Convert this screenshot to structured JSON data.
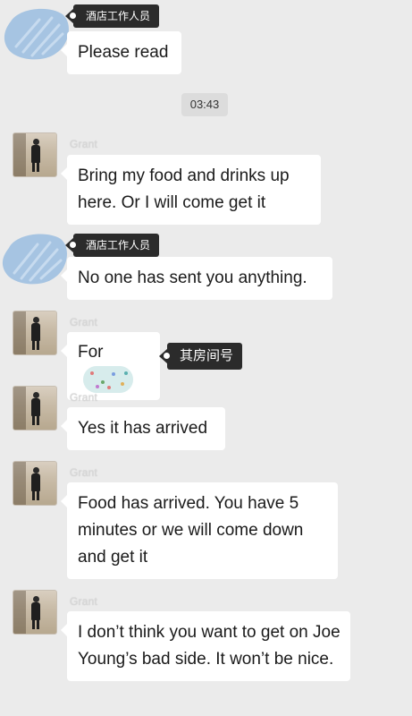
{
  "colors": {
    "background": "#ebebeb",
    "bubble": "#ffffff",
    "tag": "#2b2b2b",
    "avatar_blue": "#9fbfe0",
    "time_chip": "#dcdcdc"
  },
  "time_divider": "03:43",
  "messages": [
    {
      "sender": "酒店工作人员",
      "text": "Please read"
    },
    {
      "sender": "Grant",
      "text": "Bring my food and drinks up here. Or I will come get it"
    },
    {
      "sender": "酒店工作人员",
      "text": "No one has sent you anything."
    },
    {
      "sender": "Grant",
      "text": "For",
      "tag": "其房间号"
    },
    {
      "sender": "Grant",
      "text": "Yes it has arrived"
    },
    {
      "sender": "Grant",
      "text": "Food has arrived. You have 5 minutes or we will come down and get it"
    },
    {
      "sender": "Grant",
      "text": "I don’t think you want to get on Joe Young’s bad side. It won’t be nice."
    }
  ],
  "icons": {
    "staff_avatar": "blue-scribble-avatar",
    "grant_avatar": "person-photo-avatar",
    "room_number": "redacted-sticker"
  }
}
